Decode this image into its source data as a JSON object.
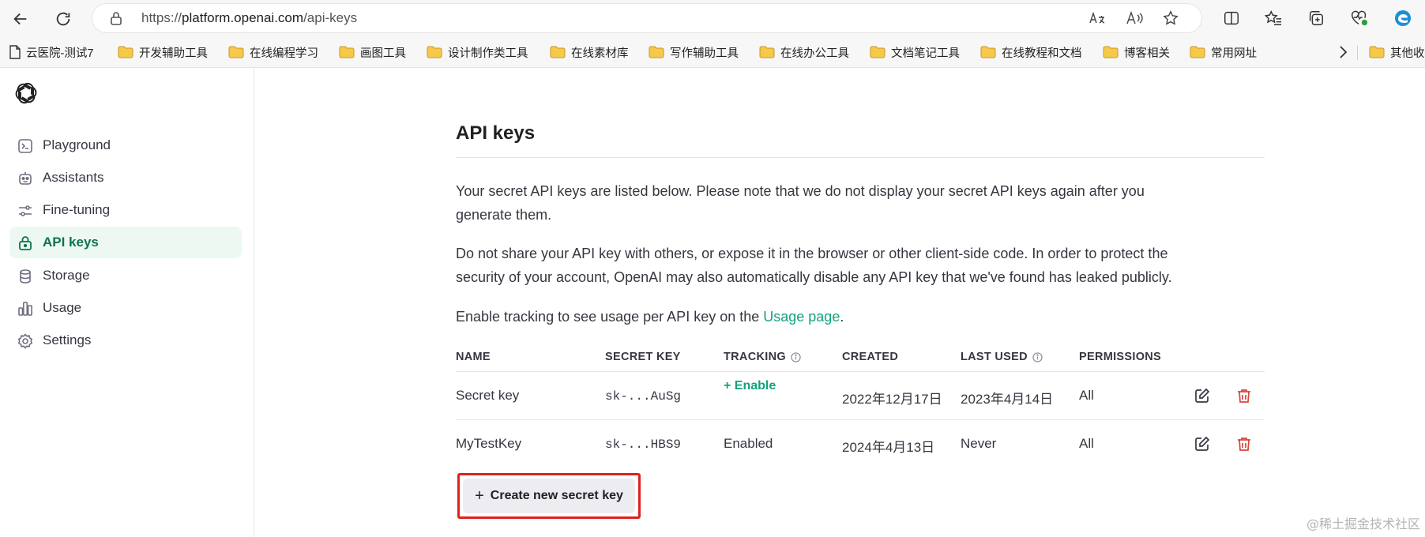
{
  "browser": {
    "url_prefix": "https://",
    "url_host": "platform.openai.com",
    "url_path": "/api-keys",
    "bookmarks": [
      {
        "label": "云医院-测试7",
        "icon": "page-icon"
      },
      {
        "label": "开发辅助工具",
        "icon": "folder-icon"
      },
      {
        "label": "在线编程学习",
        "icon": "folder-icon"
      },
      {
        "label": "画图工具",
        "icon": "folder-icon"
      },
      {
        "label": "设计制作类工具",
        "icon": "folder-icon"
      },
      {
        "label": "在线素材库",
        "icon": "folder-icon"
      },
      {
        "label": "写作辅助工具",
        "icon": "folder-icon"
      },
      {
        "label": "在线办公工具",
        "icon": "folder-icon"
      },
      {
        "label": "文档笔记工具",
        "icon": "folder-icon"
      },
      {
        "label": "在线教程和文档",
        "icon": "folder-icon"
      },
      {
        "label": "博客相关",
        "icon": "folder-icon"
      },
      {
        "label": "常用网址",
        "icon": "folder-icon"
      },
      {
        "label": "其他收",
        "icon": "folder-icon"
      }
    ]
  },
  "sidebar": {
    "items": [
      {
        "label": "Playground",
        "icon": "terminal-icon",
        "active": false
      },
      {
        "label": "Assistants",
        "icon": "robot-icon",
        "active": false
      },
      {
        "label": "Fine-tuning",
        "icon": "sliders-icon",
        "active": false
      },
      {
        "label": "API keys",
        "icon": "lock-icon",
        "active": true
      },
      {
        "label": "Storage",
        "icon": "database-icon",
        "active": false
      },
      {
        "label": "Usage",
        "icon": "bar-chart-icon",
        "active": false
      },
      {
        "label": "Settings",
        "icon": "gear-icon",
        "active": false
      }
    ]
  },
  "main": {
    "title": "API keys",
    "para1_line1": "Your secret API keys are listed below. Please note that we do not display your secret API keys again after you",
    "para1_line2": "generate them.",
    "para2_line1": "Do not share your API key with others, or expose it in the browser or other client-side code. In order to protect the",
    "para2_line2": "security of your account, OpenAI may also automatically disable any API key that we've found has leaked publicly.",
    "para3_text": "Enable tracking to see usage per API key on the ",
    "para3_link": "Usage page",
    "para3_end": ".",
    "table": {
      "headers": {
        "name": "NAME",
        "secret": "SECRET KEY",
        "tracking": "TRACKING",
        "created": "CREATED",
        "last_used": "LAST USED",
        "permissions": "PERMISSIONS"
      },
      "rows": [
        {
          "name": "Secret key",
          "secret": "sk-...AuSg",
          "tracking": "+ Enable",
          "created": "2022年12月17日",
          "last_used": "2023年4月14日",
          "permissions": "All"
        },
        {
          "name": "MyTestKey",
          "secret": "sk-...HBS9",
          "tracking": "Enabled",
          "created": "2024年4月13日",
          "last_used": "Never",
          "permissions": "All"
        }
      ]
    },
    "create_button": "Create new secret key",
    "create_icon": "+"
  },
  "watermark": "@稀土掘金技术社区",
  "colors": {
    "accent": "#10a37f",
    "active_bg": "#ecf8f1",
    "danger": "#d9453d",
    "highlight_box": "#e0201e"
  }
}
